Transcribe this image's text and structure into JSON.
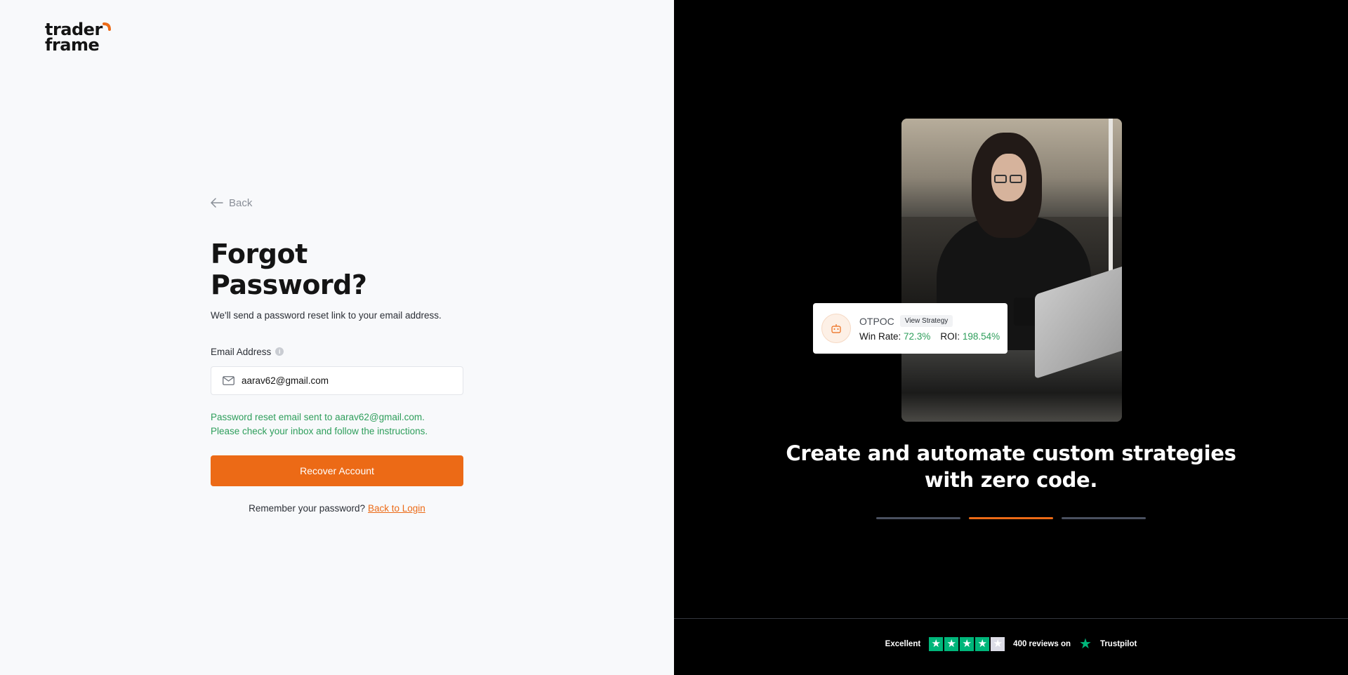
{
  "brand": {
    "line1": "trader",
    "line2": "frame",
    "accent": "#ec6a16"
  },
  "form": {
    "back_label": "Back",
    "title": "Forgot Password?",
    "subtitle": "We'll send a password reset link to your email address.",
    "email_label": "Email Address",
    "email_value": "aarav62@gmail.com",
    "success_line1": "Password reset email sent to aarav62@gmail.com.",
    "success_line2": "Please check your inbox and follow the instructions.",
    "submit_label": "Recover Account",
    "remember_text": "Remember your password?",
    "back_to_login": "Back to Login"
  },
  "promo": {
    "card": {
      "name": "OTPOC",
      "view_label": "View Strategy",
      "win_rate_label": "Win Rate:",
      "win_rate_value": "72.3%",
      "roi_label": "ROI:",
      "roi_value": "198.54%"
    },
    "headline_line1": "Create and automate custom strategies",
    "headline_line2": "with zero code.",
    "slides": {
      "count": 3,
      "active_index": 1
    }
  },
  "trustpilot": {
    "rating_label": "Excellent",
    "stars_filled": 4,
    "stars_total": 5,
    "reviews_text": "400 reviews on",
    "brand": "Trustpilot"
  },
  "colors": {
    "accent": "#ec6a16",
    "success": "#2e9e5b",
    "trust_green": "#00b67a"
  }
}
